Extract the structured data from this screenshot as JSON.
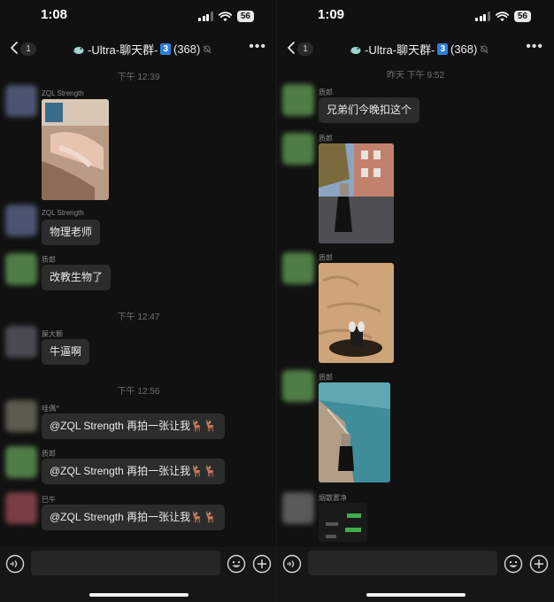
{
  "left": {
    "status": {
      "time": "1:08",
      "battery": "56"
    },
    "nav": {
      "badge": "1",
      "title_prefix": "-Ultra-聊天群-",
      "title_num": "3",
      "member_count": "(368)"
    },
    "messages": {
      "ts1": "下午 12:39",
      "m1_user": "ZQL Strength",
      "m2_user": "ZQL Strength",
      "m2_text": "物理老师",
      "m3_user": "质郎",
      "m3_text": "改教生物了",
      "ts2": "下午 12:47",
      "m4_user": "屎大颗",
      "m4_text": "牛逼啊",
      "ts3": "下午 12:56",
      "m5_user": "哇偶^",
      "m5_text": "@ZQL Strength 再拍一张让我🦌🦌",
      "m6_user": "质郎",
      "m6_text": "@ZQL Strength 再拍一张让我🦌🦌",
      "m7_user": "巳午",
      "m7_text": "@ZQL Strength 再拍一张让我🦌🦌"
    }
  },
  "right": {
    "status": {
      "time": "1:09",
      "battery": "56"
    },
    "nav": {
      "badge": "1",
      "title_prefix": "-Ultra-聊天群-",
      "title_num": "3",
      "member_count": "(368)"
    },
    "messages": {
      "ts1": "昨天 下午 9:52",
      "m1_user": "质郎",
      "m1_text": "兄弟们今晚扣这个",
      "m2_user": "质郎",
      "m3_user": "质郎",
      "m4_user": "质郎",
      "m5_user": "烟散雾净"
    }
  },
  "icons": {
    "back": "chevron-left-icon",
    "more": "more-dots-icon",
    "voice": "voice-icon",
    "emoji": "emoji-icon",
    "plus": "plus-icon",
    "mute": "mute-bell-icon",
    "group": "bird-icon"
  },
  "colors": {
    "background": "#111111",
    "bubble": "#2c2c2c",
    "badge_blue": "#2f7fd6",
    "timestamp": "#6f6f6f"
  }
}
